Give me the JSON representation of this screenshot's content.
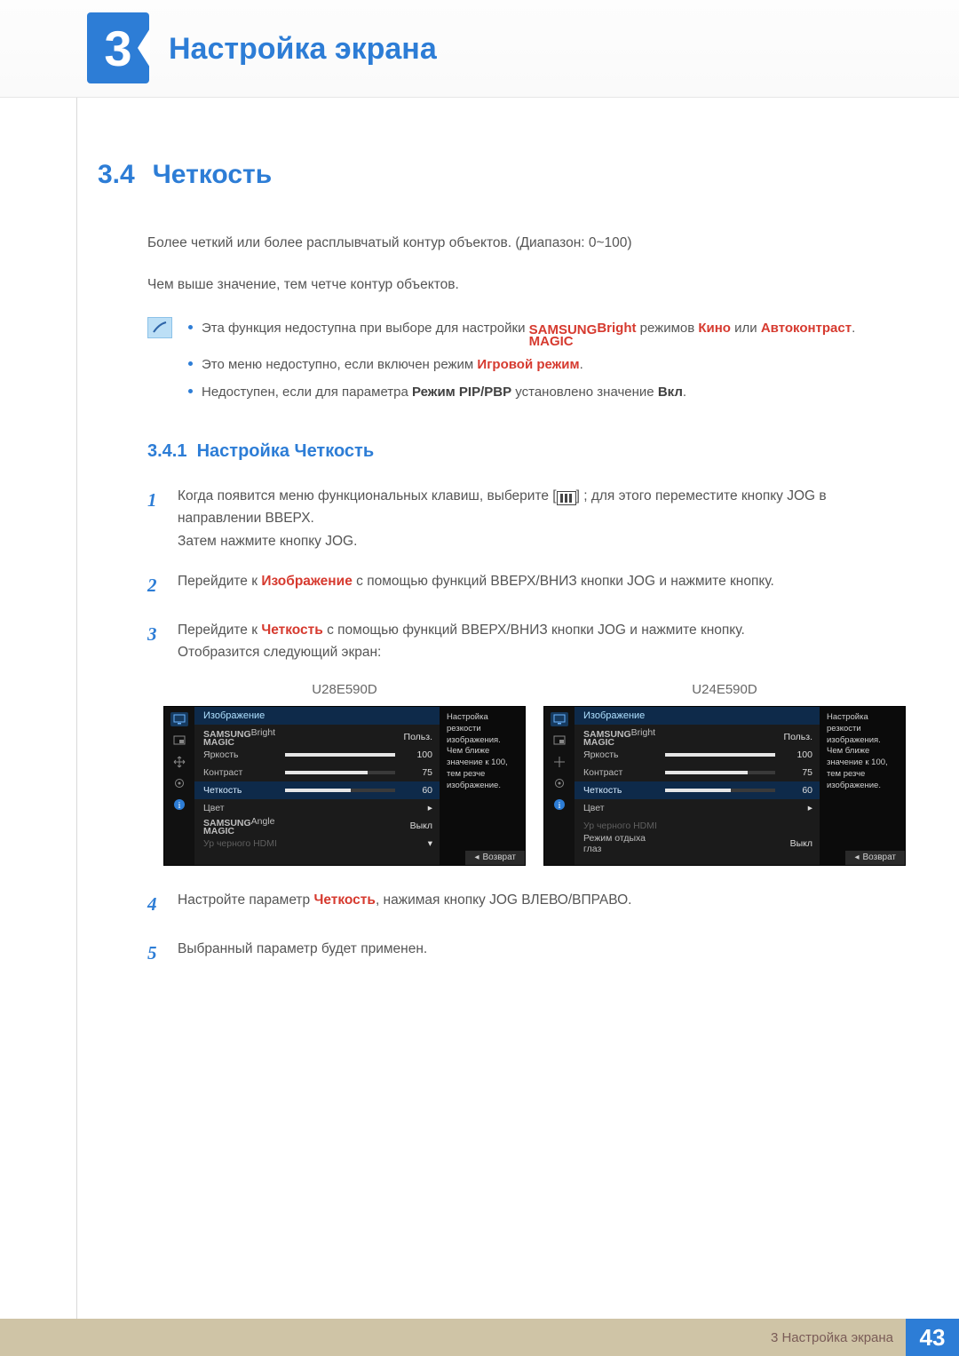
{
  "chapter": {
    "number": "3",
    "title": "Настройка экрана"
  },
  "section": {
    "number": "3.4",
    "title": "Четкость"
  },
  "paragraphs": {
    "p1": "Более четкий или более расплывчатый контур объектов. (Диапазон: 0~100)",
    "p2": "Чем выше значение, тем четче контур объектов."
  },
  "notes": {
    "n1_a": "Эта функция недоступна при выборе для настройки ",
    "n1_b": "Bright",
    "n1_c": " режимов ",
    "n1_d": "Кино",
    "n1_e": " или ",
    "n1_f": "Автоконтраст",
    "n1_g": ".",
    "n2_a": "Это меню недоступно, если включен режим ",
    "n2_b": "Игровой режим",
    "n2_c": ".",
    "n3_a": "Недоступен, если для параметра ",
    "n3_b": "Режим PIP/PBP",
    "n3_c": " установлено значение ",
    "n3_d": "Вкл",
    "n3_e": "."
  },
  "magic": {
    "top": "SAMSUNG",
    "bot": "MAGIC"
  },
  "subsection": {
    "number": "3.4.1",
    "title": "Настройка Четкость"
  },
  "steps": {
    "s1a": "Когда появится меню функциональных клавиш, выберите [",
    "s1b": "] ; для этого переместите кнопку JOG в направлении ВВЕРХ.",
    "s1c": "Затем нажмите кнопку JOG.",
    "s2a": "Перейдите к ",
    "s2b": "Изображение",
    "s2c": " с помощью функций ВВЕРХ/ВНИЗ кнопки JOG и нажмите кнопку.",
    "s3a": "Перейдите к ",
    "s3b": "Четкость",
    "s3c": " с помощью функций ВВЕРХ/ВНИЗ кнопки JOG и нажмите кнопку.",
    "s3d": "Отобразится следующий экран:",
    "s4a": "Настройте параметр ",
    "s4b": "Четкость",
    "s4c": ", нажимая кнопку JOG ВЛЕВО/ВПРАВО.",
    "s5": "Выбранный параметр будет применен."
  },
  "osd": {
    "model_a": "U28E590D",
    "model_b": "U24E590D",
    "header": "Изображение",
    "panel_text": "Настройка резкости изображения. Чем ближе значение к 100, тем резче изображение.",
    "return": "Возврат",
    "rows_a": [
      {
        "label_magic": true,
        "suffix": "Bright",
        "value": "Польз."
      },
      {
        "label": "Яркость",
        "slider": 100,
        "value": "100"
      },
      {
        "label": "Контраст",
        "slider": 75,
        "value": "75"
      },
      {
        "label": "Четкость",
        "slider": 60,
        "value": "60",
        "highlight": true
      },
      {
        "label": "Цвет",
        "chevron": true
      },
      {
        "label_magic": true,
        "suffix": "Angle",
        "value": "Выкл"
      },
      {
        "label": "Ур черного HDMI",
        "dim": true,
        "chevron_down": true
      }
    ],
    "rows_b": [
      {
        "label_magic": true,
        "suffix": "Bright",
        "value": "Польз."
      },
      {
        "label": "Яркость",
        "slider": 100,
        "value": "100"
      },
      {
        "label": "Контраст",
        "slider": 75,
        "value": "75"
      },
      {
        "label": "Четкость",
        "slider": 60,
        "value": "60",
        "highlight": true
      },
      {
        "label": "Цвет",
        "chevron": true
      },
      {
        "label": "Ур черного HDMI",
        "dim": true
      },
      {
        "label": "Режим отдыха глаз",
        "value": "Выкл"
      }
    ]
  },
  "footer": {
    "text": "3 Настройка экрана",
    "page": "43"
  }
}
